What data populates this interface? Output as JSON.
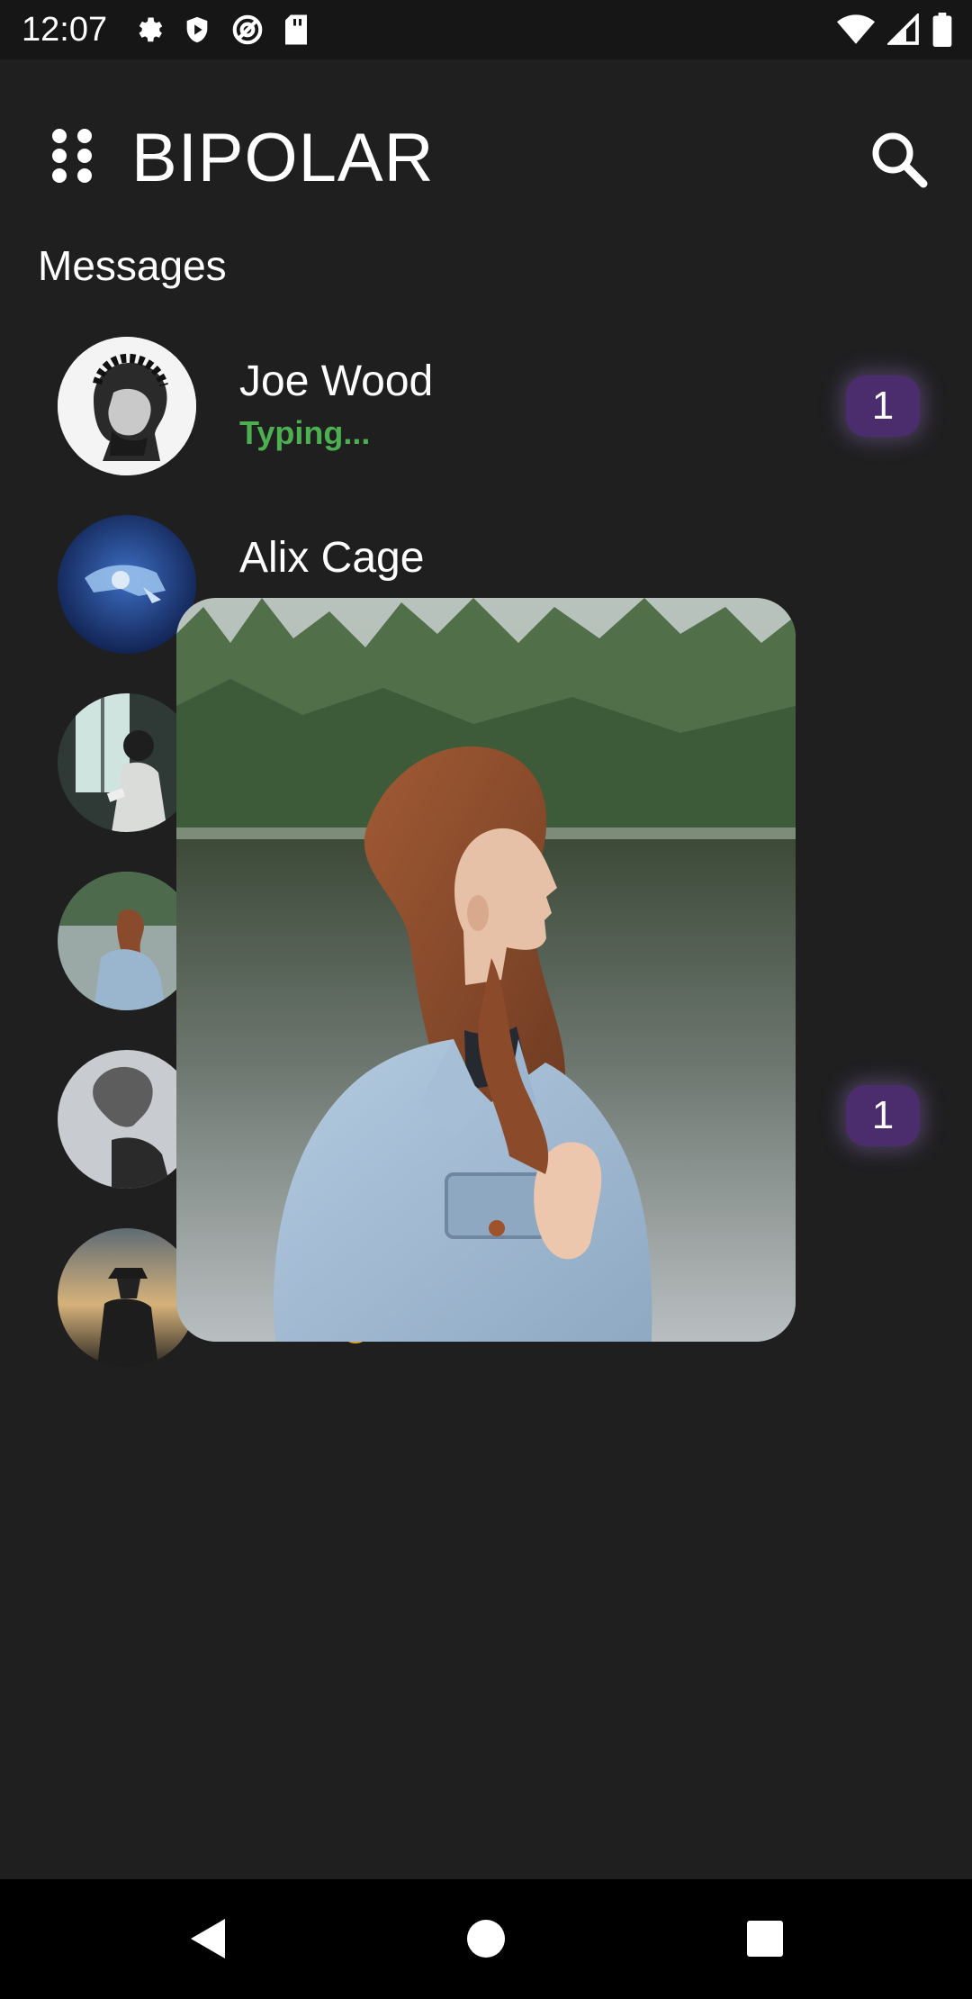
{
  "status_bar": {
    "time": "12:07",
    "left_icons": [
      "settings-icon",
      "shield-icon",
      "no-location-icon",
      "sd-card-icon"
    ],
    "right_icons": [
      "wifi-icon",
      "cell-signal-icon",
      "battery-icon"
    ]
  },
  "app_bar": {
    "title": "BIPOLAR",
    "menu_icon": "apps-grid-icon",
    "search_icon": "search-icon"
  },
  "section_title": "Messages",
  "conversations": [
    {
      "name": "Joe Wood",
      "subtitle": "Typing...",
      "unread": "1"
    },
    {
      "name": "Alix Cage",
      "subtitle": "",
      "unread": ""
    },
    {
      "name": "",
      "subtitle": "",
      "unread": ""
    },
    {
      "name": "",
      "subtitle": "",
      "unread": ""
    },
    {
      "name": "",
      "subtitle": "",
      "unread": "1"
    },
    {
      "name": "",
      "subtitle": "",
      "unread": ""
    }
  ],
  "preview": {
    "description_icon": "profile-photo-preview"
  },
  "nav_bar": {
    "icons": [
      "back-icon",
      "home-icon",
      "recents-icon"
    ]
  },
  "colors": {
    "background": "#1f1f20",
    "badge": "#4b2d6e",
    "typing": "#4caf50"
  }
}
